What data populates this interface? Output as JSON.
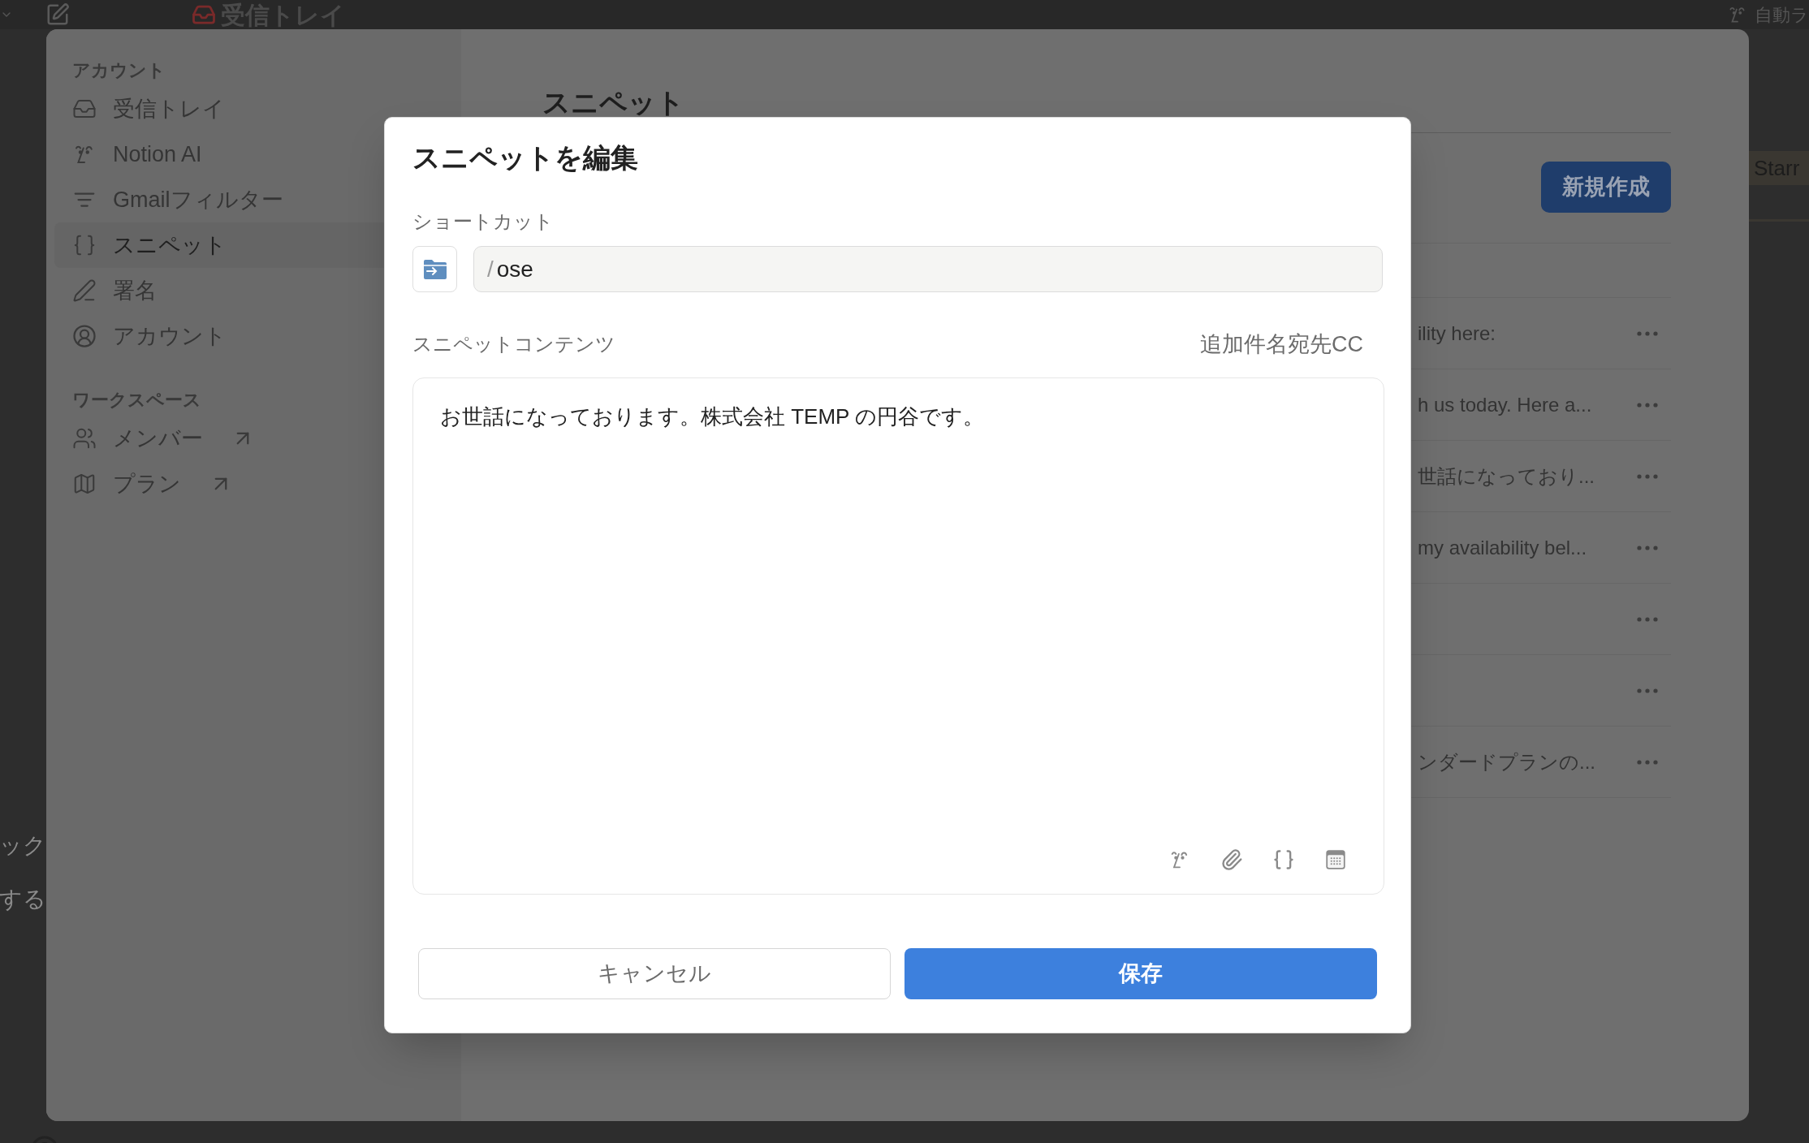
{
  "top_bar": {
    "title": "受信トレイ",
    "right_label": "自動ラ"
  },
  "background": {
    "left_texts": [
      "ック",
      "する"
    ],
    "right_label": "Starr"
  },
  "settings": {
    "sidebar": [
      {
        "heading": "アカウント",
        "items": [
          {
            "label": "受信トレイ",
            "kind": "inbox",
            "selected": false,
            "external": false
          },
          {
            "label": "Notion AI",
            "kind": "ai",
            "selected": false,
            "external": false
          },
          {
            "label": "Gmailフィルター",
            "kind": "filter",
            "selected": false,
            "external": false
          },
          {
            "label": "スニペット",
            "kind": "braces",
            "selected": true,
            "external": false
          },
          {
            "label": "署名",
            "kind": "pen",
            "selected": false,
            "external": false
          },
          {
            "label": "アカウント",
            "kind": "user",
            "selected": false,
            "external": false
          }
        ]
      },
      {
        "heading": "ワークスペース",
        "items": [
          {
            "label": "メンバー",
            "kind": "people",
            "selected": false,
            "external": true
          },
          {
            "label": "プラン",
            "kind": "map",
            "selected": false,
            "external": true
          }
        ]
      }
    ],
    "main": {
      "title": "スニペット",
      "new_button": "新規作成",
      "rows": [
        {
          "text": "ility here:"
        },
        {
          "text": "h us today. Here a..."
        },
        {
          "text": "世話になっており..."
        },
        {
          "text": "my availability bel..."
        },
        {},
        {},
        {
          "text": "ンダードプランの..."
        }
      ]
    }
  },
  "dialog": {
    "title": "スニペットを編集",
    "shortcut_label": "ショートカット",
    "shortcut": {
      "prefix": "/",
      "value": "ose"
    },
    "content_label": "スニペットコンテンツ",
    "extra_link": "追加件名宛先CC",
    "content": "お世話になっております。株式会社 TEMP の円谷です。",
    "cancel": "キャンセル",
    "save": "保存"
  }
}
